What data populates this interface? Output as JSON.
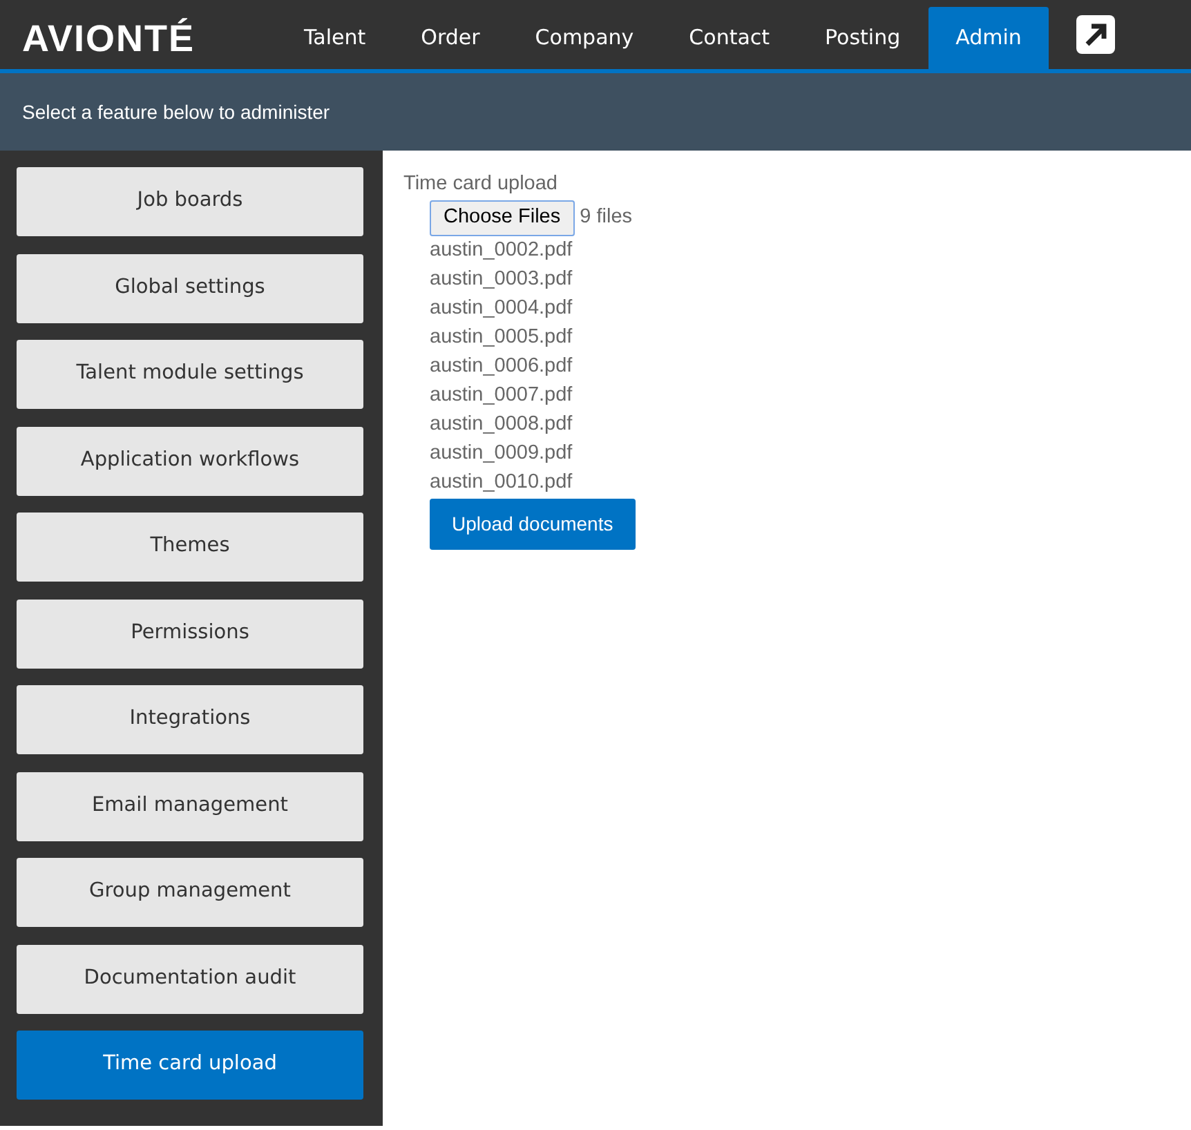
{
  "brand": "AVIONTÉ",
  "nav": [
    {
      "label": "Talent",
      "selected": false
    },
    {
      "label": "Order",
      "selected": false
    },
    {
      "label": "Company",
      "selected": false
    },
    {
      "label": "Contact",
      "selected": false
    },
    {
      "label": "Posting",
      "selected": false
    },
    {
      "label": "Admin",
      "selected": true
    }
  ],
  "subheader": "Select a feature below to administer",
  "sidebar": {
    "items": [
      {
        "label": "Job boards",
        "selected": false
      },
      {
        "label": "Global settings",
        "selected": false
      },
      {
        "label": "Talent module settings",
        "selected": false
      },
      {
        "label": "Application workflows",
        "selected": false
      },
      {
        "label": "Themes",
        "selected": false
      },
      {
        "label": "Permissions",
        "selected": false
      },
      {
        "label": "Integrations",
        "selected": false
      },
      {
        "label": "Email management",
        "selected": false
      },
      {
        "label": "Group management",
        "selected": false
      },
      {
        "label": "Documentation audit",
        "selected": false
      },
      {
        "label": "Time card upload",
        "selected": true
      }
    ]
  },
  "content": {
    "title": "Time card upload",
    "choose_button": "Choose Files",
    "file_count": "9 files",
    "files": [
      "austin_0002.pdf",
      "austin_0003.pdf",
      "austin_0004.pdf",
      "austin_0005.pdf",
      "austin_0006.pdf",
      "austin_0007.pdf",
      "austin_0008.pdf",
      "austin_0009.pdf",
      "austin_0010.pdf"
    ],
    "upload_button": "Upload documents"
  }
}
